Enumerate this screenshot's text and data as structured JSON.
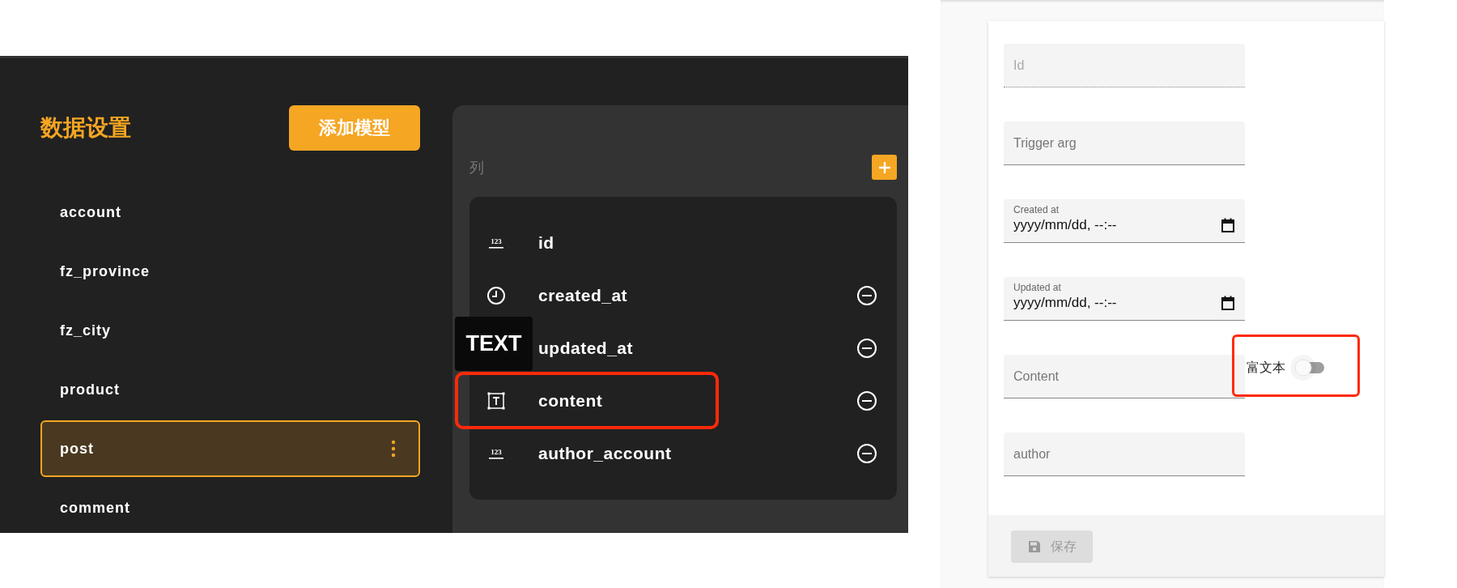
{
  "sidebar": {
    "title": "数据设置",
    "add_button": "添加模型",
    "items": [
      {
        "label": "account",
        "selected": false
      },
      {
        "label": "fz_province",
        "selected": false
      },
      {
        "label": "fz_city",
        "selected": false
      },
      {
        "label": "product",
        "selected": false
      },
      {
        "label": "post",
        "selected": true
      },
      {
        "label": "comment",
        "selected": false
      }
    ]
  },
  "columns_panel": {
    "heading": "列",
    "tooltip": "TEXT",
    "columns": [
      {
        "name": "id",
        "kind": "number",
        "badge": "123",
        "removable": false,
        "highlighted": false
      },
      {
        "name": "created_at",
        "kind": "datetime",
        "removable": true,
        "highlighted": false
      },
      {
        "name": "updated_at",
        "kind": "datetime",
        "removable": true,
        "highlighted": false
      },
      {
        "name": "content",
        "kind": "text",
        "removable": true,
        "highlighted": true
      },
      {
        "name": "author_account",
        "kind": "number",
        "badge": "123",
        "removable": true,
        "highlighted": false
      }
    ]
  },
  "form": {
    "fields": [
      {
        "kind": "text",
        "placeholder": "Id",
        "disabled": true
      },
      {
        "kind": "text",
        "placeholder": "Trigger arg",
        "disabled": false
      },
      {
        "kind": "datetime",
        "label": "Created at",
        "value": "yyyy/mm/dd, --:--"
      },
      {
        "kind": "datetime",
        "label": "Updated at",
        "value": "yyyy/mm/dd, --:--"
      },
      {
        "kind": "text",
        "placeholder": "Content",
        "disabled": false,
        "toggle": {
          "label": "富文本",
          "on": false,
          "highlighted": true
        }
      },
      {
        "kind": "text",
        "placeholder": "author",
        "disabled": false
      }
    ],
    "save_button": {
      "label": "保存",
      "disabled": true
    }
  }
}
